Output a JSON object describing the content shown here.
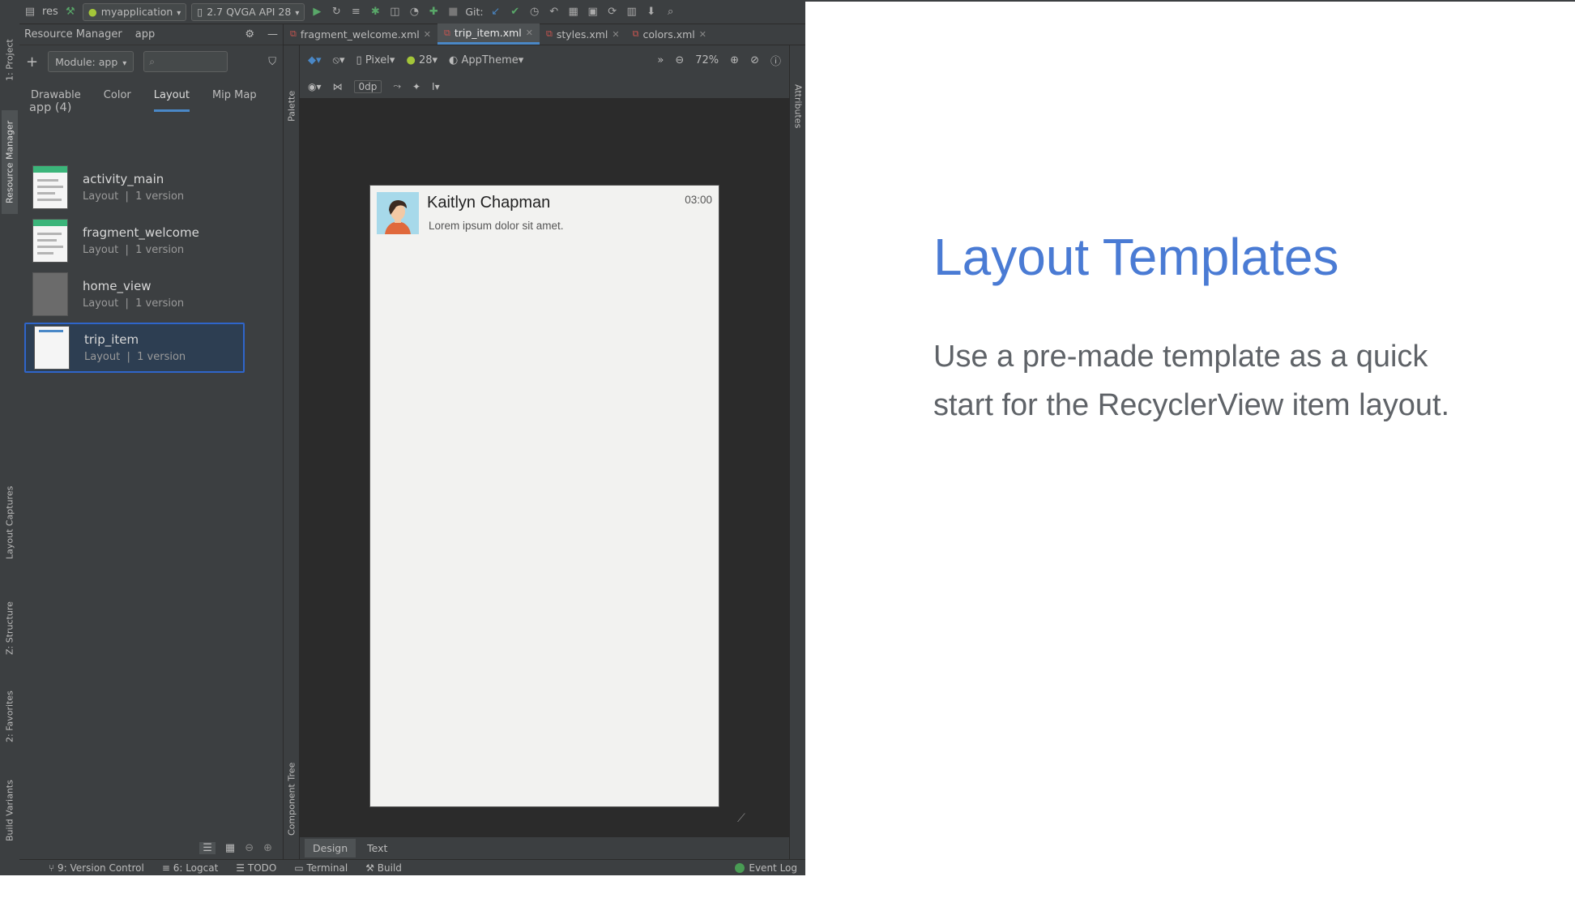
{
  "toolbar": {
    "project": "res",
    "config": "myapplication",
    "device": "2.7 QVGA API 28",
    "git_label": "Git:"
  },
  "side_tabs": [
    "1: Project",
    "Resource Manager",
    "Layout Captures",
    "Z: Structure",
    "2: Favorites",
    "Build Variants"
  ],
  "resource_manager": {
    "title": "Resource Manager",
    "module_tab": "app",
    "module_select": "Module: app",
    "search_placeholder": "",
    "tabs": [
      "Drawable",
      "Color",
      "Layout",
      "Mip Map"
    ],
    "active_tab": "Layout",
    "group": "app (4)",
    "items": [
      {
        "name": "activity_main",
        "type": "Layout",
        "versions": "1 version"
      },
      {
        "name": "fragment_welcome",
        "type": "Layout",
        "versions": "1 version"
      },
      {
        "name": "home_view",
        "type": "Layout",
        "versions": "1 version"
      },
      {
        "name": "trip_item",
        "type": "Layout",
        "versions": "1 version"
      }
    ]
  },
  "file_tabs": [
    "fragment_welcome.xml",
    "trip_item.xml",
    "styles.xml",
    "colors.xml"
  ],
  "design_toolbar": {
    "device": "Pixel",
    "api": "28",
    "theme": "AppTheme",
    "zoom": "72%",
    "margin": "0dp"
  },
  "side_strips": {
    "palette": "Palette",
    "attributes": "Attributes",
    "component_tree": "Component Tree"
  },
  "preview": {
    "name": "Kaitlyn Chapman",
    "message": "Lorem ipsum dolor sit amet.",
    "time": "03:00"
  },
  "mode_tabs": [
    "Design",
    "Text"
  ],
  "status_bar": [
    "9: Version Control",
    "6: Logcat",
    "TODO",
    "Terminal",
    "Build"
  ],
  "event_log": "Event Log",
  "slide": {
    "title": "Layout Templates",
    "body": "Use a pre-made template as a quick start for the RecyclerView item layout."
  }
}
